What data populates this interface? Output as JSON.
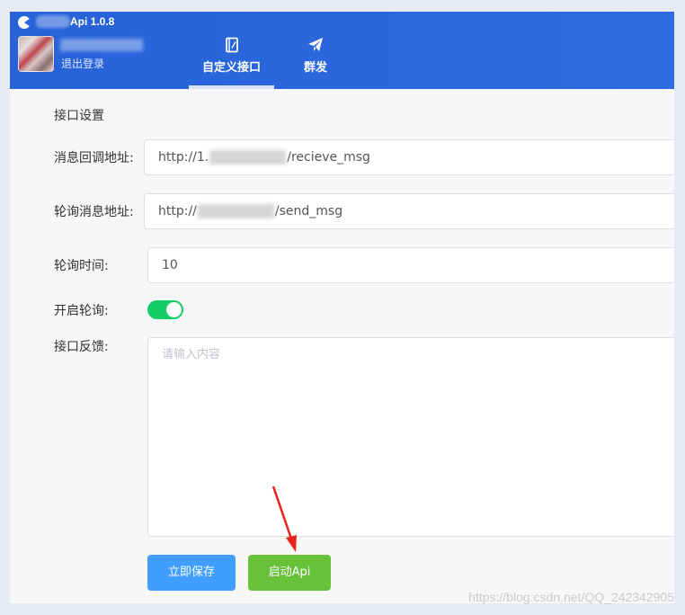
{
  "header": {
    "app_title": "Api 1.0.8",
    "logout_label": "退出登录",
    "tabs": [
      {
        "label": "自定义接口",
        "icon": "notebook-icon",
        "active": true
      },
      {
        "label": "群发",
        "icon": "paper-plane-icon",
        "active": false
      }
    ]
  },
  "form": {
    "section_title": "接口设置",
    "callback": {
      "label": "消息回调地址:",
      "value_prefix": "http://1.",
      "value_suffix": "/recieve_msg"
    },
    "polling": {
      "label": "轮询消息地址:",
      "value_prefix": "http://",
      "value_suffix": "/send_msg"
    },
    "interval": {
      "label": "轮询时间:",
      "value": "10"
    },
    "enable_polling": {
      "label": "开启轮询:",
      "on": true
    },
    "feedback": {
      "label": "接口反馈:",
      "placeholder": "请输入内容"
    },
    "save_button": "立即保存",
    "start_button": "启动Api"
  },
  "watermark": "https://blog.csdn.net/QQ_242342905",
  "colors": {
    "header": "#2d68de",
    "toggle_on": "#13ce66",
    "save_button": "#409eff",
    "start_button": "#67c23a",
    "annotation_arrow": "#e8231b"
  }
}
